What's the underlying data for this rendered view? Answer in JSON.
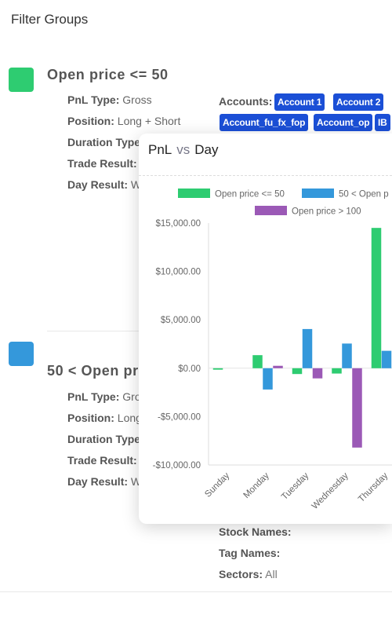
{
  "page_title": "Filter Groups",
  "groups": [
    {
      "title": "Open price <= 50",
      "color": "#2ecc71",
      "fields": [
        {
          "label": "PnL Type:",
          "value": "Gross"
        },
        {
          "label": "Position:",
          "value": "Long + Short"
        },
        {
          "label": "Duration Type",
          "value": ""
        },
        {
          "label": "Trade Result:",
          "value": ""
        },
        {
          "label": "Day Result:",
          "value": "W"
        }
      ],
      "accounts_label": "Accounts:",
      "accounts": [
        "Account 1",
        "Account 2",
        "Account_fu_fx_fop",
        "Account_op",
        "IB"
      ]
    },
    {
      "title": "50 < Open pr",
      "color": "#3498db",
      "fields": [
        {
          "label": "PnL Type:",
          "value": "Gro"
        },
        {
          "label": "Position:",
          "value": "Long"
        },
        {
          "label": "Duration Type",
          "value": ""
        },
        {
          "label": "Trade Result:",
          "value": ""
        },
        {
          "label": "Day Result:",
          "value": "W"
        }
      ],
      "right_fields": [
        {
          "label": "Stock Names:",
          "value": ""
        },
        {
          "label": "Tag Names:",
          "value": ""
        },
        {
          "label": "Sectors:",
          "value": "All"
        }
      ]
    }
  ],
  "popup": {
    "title_left": "PnL",
    "title_vs": "vs",
    "title_right": "Day"
  },
  "chart_data": {
    "type": "bar",
    "categories": [
      "Sunday",
      "Monday",
      "Tuesday",
      "Wednesday",
      "Thursday"
    ],
    "series": [
      {
        "name": "Open price <= 50",
        "color": "#2ecc71",
        "values": [
          -150,
          1350,
          -600,
          -550,
          14500
        ]
      },
      {
        "name": "50 < Open p",
        "color": "#3498db",
        "values": [
          0,
          -2200,
          4050,
          2550,
          1800
        ]
      },
      {
        "name": "Open price > 100",
        "color": "#9b59b6",
        "values": [
          0,
          250,
          -1050,
          -8200,
          null
        ]
      }
    ],
    "ylim": [
      -10000,
      15000
    ],
    "yticks": [
      "$15,000.00",
      "$10,000.00",
      "$5,000.00",
      "$0.00",
      "-$5,000.00",
      "-$10,000.00"
    ],
    "ytick_values": [
      15000,
      10000,
      5000,
      0,
      -5000,
      -10000
    ],
    "legend_position": "top",
    "grid": false
  }
}
